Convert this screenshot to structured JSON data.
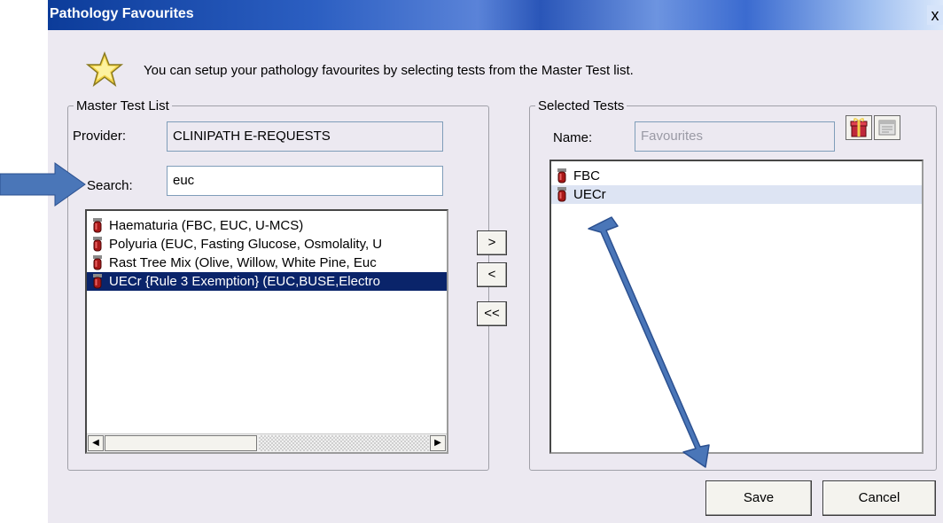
{
  "window": {
    "title": "Pathology Favourites",
    "close_label": "x"
  },
  "intro": {
    "text": "You can setup your pathology favourites by selecting tests from the Master Test list."
  },
  "master": {
    "legend": "Master Test List",
    "provider_label": "Provider:",
    "provider_value": "CLINIPATH E-REQUESTS",
    "search_label": "Search:",
    "search_value": "euc",
    "items": [
      "Haematuria (FBC, EUC, U-MCS)",
      "Polyuria (EUC, Fasting Glucose, Osmolality, U",
      "Rast Tree Mix (Olive, Willow, White Pine, Euc",
      "UECr {Rule 3 Exemption} (EUC,BUSE,Electro"
    ],
    "selected_index": 3
  },
  "transfer": {
    "add_label": ">",
    "remove_label": "<",
    "remove_all_label": "<<"
  },
  "selected": {
    "legend": "Selected Tests",
    "name_label": "Name:",
    "name_value": "Favourites",
    "items": [
      "FBC",
      "UECr"
    ],
    "highlighted_index": 1
  },
  "footer": {
    "save_label": "Save",
    "cancel_label": "Cancel"
  },
  "colors": {
    "titlebar": "#0c3c9a",
    "selection": "#0a246a",
    "annotation_arrow": "#4a76b8"
  },
  "icons": {
    "star": "star-icon",
    "tube": "test-tube-icon",
    "gift": "gift-icon",
    "properties": "properties-icon"
  }
}
